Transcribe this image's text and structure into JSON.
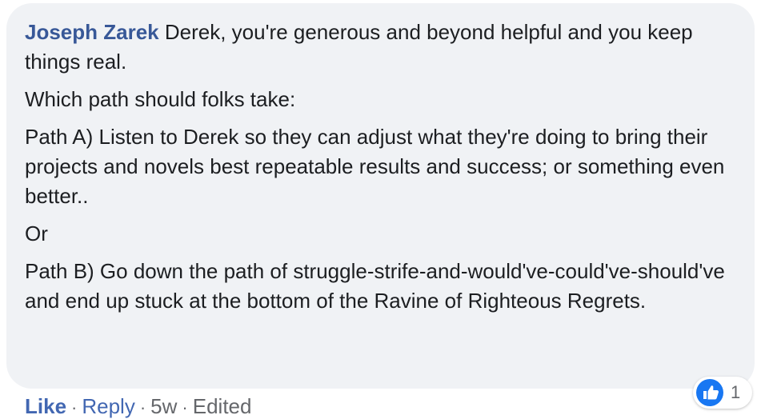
{
  "comment": {
    "author": "Joseph Zarek",
    "intro_text": " Derek, you're generous and beyond helpful and you keep things real.",
    "paragraphs": [
      "Which path should folks take:",
      "Path A) Listen to Derek so they can adjust what they're doing to bring their projects and novels best repeatable results and success; or something even better..",
      "Or",
      "Path B) Go down the path of struggle-strife-and-would've-could've-should've and end up stuck at the bottom of the Ravine of Righteous Regrets."
    ]
  },
  "actions": {
    "like_label": "Like",
    "reply_label": "Reply",
    "separator": "·",
    "timestamp": "5w",
    "edited_label": "Edited"
  },
  "reactions": {
    "icon": "thumbs-up-icon",
    "count": "1",
    "accent_color": "#1877f2"
  },
  "colors": {
    "bubble_background": "#f0f2f5",
    "author_name": "#385898",
    "link_blue": "#4267b2",
    "body_text": "#1c1e21",
    "meta_text": "#65676b"
  }
}
